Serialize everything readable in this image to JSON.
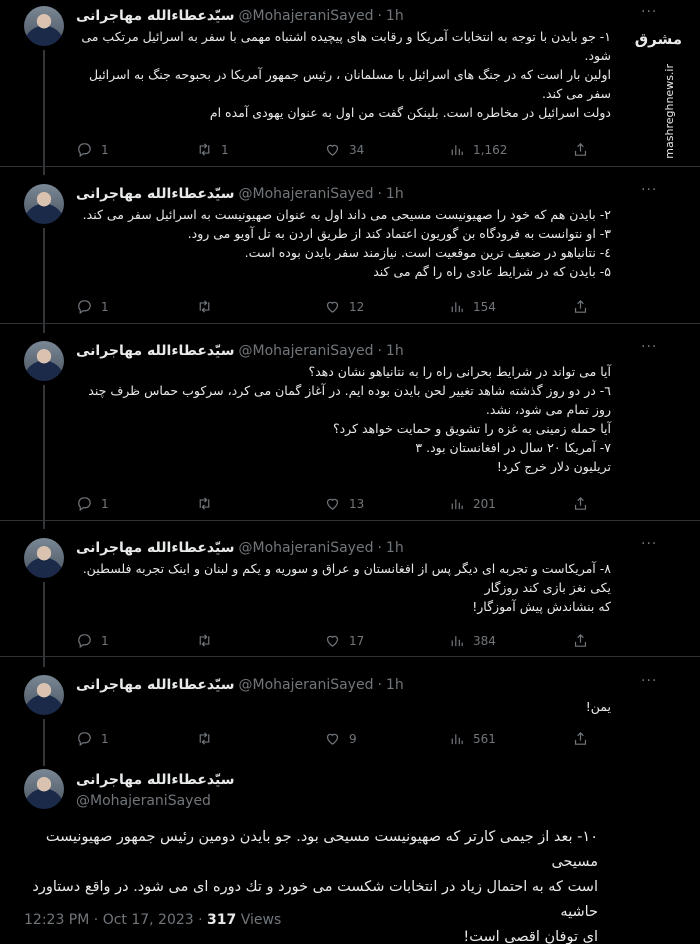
{
  "author": {
    "name": "سیّدعطاءالله مهاجرانی",
    "handle": "@MohajeraniSayed"
  },
  "watermark": {
    "logo": "مشرق",
    "site": "mashreghnews.ir"
  },
  "more_label": "···",
  "tweets": [
    {
      "time": "1h",
      "lines": [
        "۱- جو بایدن با توجه به انتخابات آمریکا و رقابت های پیچیده اشتباه مهمی با سفر به  اسرائیل مرتکب می",
        "شود.",
        "اولین بار است که در جنگ های اسرائیل با مسلمانان ، رئیس جمهور آمریکا در بحبوحه جنگ به اسرائیل",
        "سفر می کند.",
        "دولت اسرائیل در مخاطره است. بلینکن گفت من اول به عنوان یهودی آمده ام"
      ],
      "replies": "1",
      "retweets": "1",
      "likes": "34",
      "views": "1,162"
    },
    {
      "time": "1h",
      "lines": [
        "۲- بایدن هم که خود را صهیونیست مسیحی می داند اول به عنوان صهیونیست به اسرائیل سفر می کند.",
        "۳- او نتوانست به فرودگاه بن گوریون اعتماد کند از طریق اردن به تل آویو می رود.",
        "٤- نتانیاهو در ضعیف ترین موقعیت  است. نیازمند سفر بایدن بوده است.",
        "۵- بایدن که در شرایط عادی راه را گم می کند"
      ],
      "replies": "1",
      "retweets": "",
      "likes": "12",
      "views": "154"
    },
    {
      "time": "1h",
      "lines": [
        "آیا می تواند در شرایط بحرانی راه را به نتانیاهو نشان دهد؟",
        "٦- در دو روز گذشته شاهد تغییر لحن بایدن بوده ایم. در آغاز گمان می کرد، سرکوب حماس ظرف چند",
        "روز تمام می شود، نشد.",
        "آیا حمله زمینی به غزه را تشویق و حمایت خواهد کرد؟",
        "۷- آمریکا ۲۰ سال در افغانستان بود. ۳",
        "تریلیون دلار خرج کرد!"
      ],
      "replies": "1",
      "retweets": "",
      "likes": "13",
      "views": "201"
    },
    {
      "time": "1h",
      "lines": [
        "۸- آمریکاست و تجربه ای دیگر پس از افغانستان و عراق و سوریه و یکم و لبنان  و اینک تجربه فلسطین.",
        "یکی نغز بازی کند روزگار",
        "که بنشاندش پیش آموزگار!"
      ],
      "replies": "1",
      "retweets": "",
      "likes": "17",
      "views": "384"
    },
    {
      "time": "1h",
      "lines": [
        "یمن!"
      ],
      "replies": "1",
      "retweets": "",
      "likes": "9",
      "views": "561"
    }
  ],
  "main_tweet": {
    "lines": [
      "۱۰- بعد از جیمی کارتر که صهیونیست مسیحی بود. جو بایدن دومین رئیس جمهور صهیونیست مسیحی",
      "است که به احتمال زیاد در انتخابات شکست می خورد و تك دوره ای می شود. در واقع دستاورد حاشیه",
      "ای  توفان اقصی است!"
    ],
    "time": "12:23 PM",
    "date": "Oct 17, 2023",
    "views_count": "317",
    "views_label": "Views"
  }
}
